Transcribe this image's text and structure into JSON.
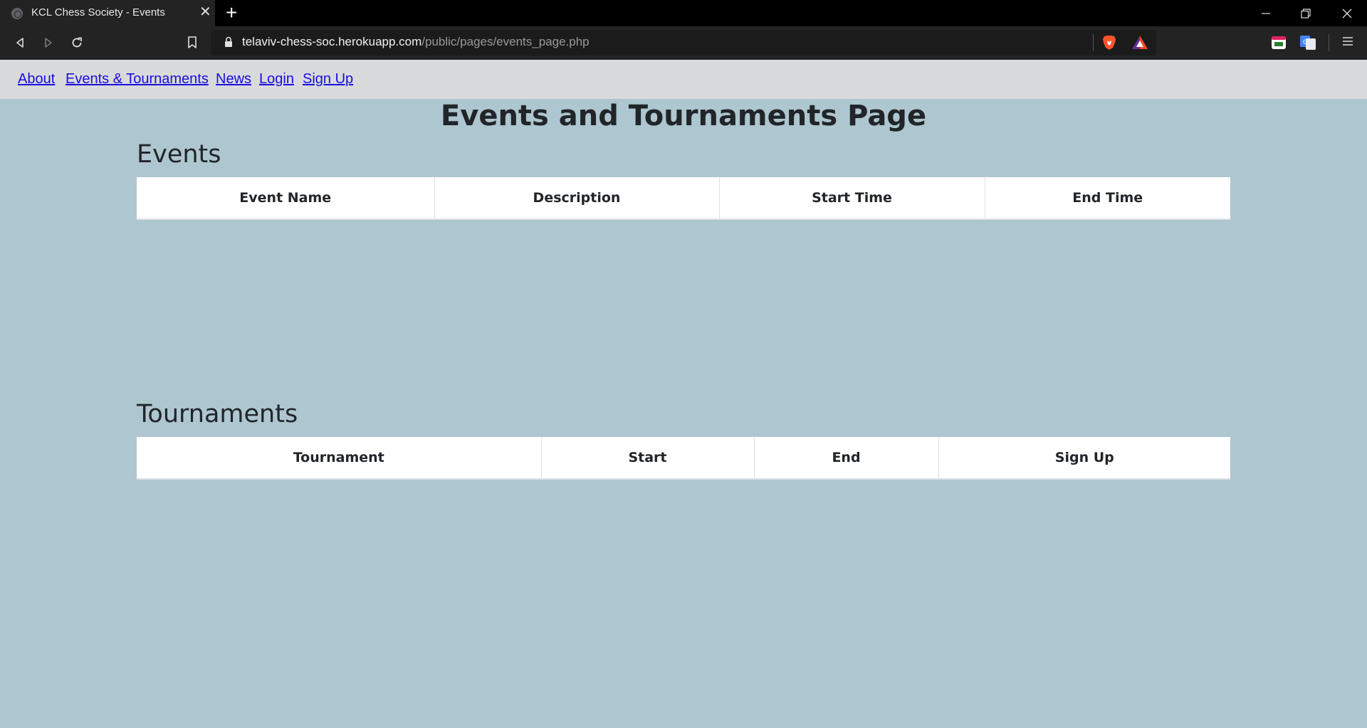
{
  "browser": {
    "tab_title": "KCL Chess Society - Events",
    "tab_close_glyph": "✕",
    "new_tab_glyph": "+",
    "url_host": "telaviv-chess-soc.herokuapp.com",
    "url_path": "/public/pages/events_page.php"
  },
  "nav": {
    "links": [
      "About",
      "Events & Tournaments",
      "News",
      "Login",
      "Sign Up"
    ]
  },
  "page": {
    "title": "Events and Tournaments Page"
  },
  "events": {
    "heading": "Events",
    "columns": [
      "Event Name",
      "Description",
      "Start Time",
      "End Time"
    ]
  },
  "tournaments": {
    "heading": "Tournaments",
    "columns": [
      "Tournament",
      "Start",
      "End",
      "Sign Up"
    ]
  },
  "colors": {
    "page_background": "#aec6cf",
    "navbar_background": "#d9dadc",
    "link": "#1a0dde"
  }
}
